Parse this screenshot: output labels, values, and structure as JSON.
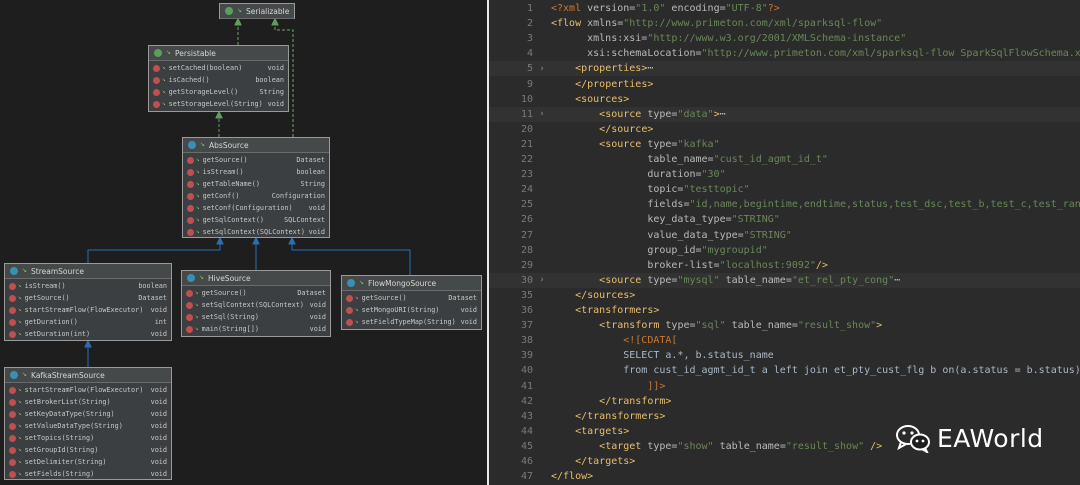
{
  "diagram": {
    "classes": [
      {
        "name": "Serializable",
        "kind": "interface",
        "methods": []
      },
      {
        "name": "Persistable",
        "kind": "interface",
        "methods": [
          {
            "name": "setCached(boolean)",
            "ret": "void"
          },
          {
            "name": "isCached()",
            "ret": "boolean"
          },
          {
            "name": "getStorageLevel()",
            "ret": "String"
          },
          {
            "name": "setStorageLevel(String)",
            "ret": "void"
          }
        ]
      },
      {
        "name": "AbsSource",
        "kind": "abstract",
        "methods": [
          {
            "name": "getSource()",
            "ret": "Dataset"
          },
          {
            "name": "isStream()",
            "ret": "boolean"
          },
          {
            "name": "getTableName()",
            "ret": "String"
          },
          {
            "name": "getConf()",
            "ret": "Configuration"
          },
          {
            "name": "setConf(Configuration)",
            "ret": "void"
          },
          {
            "name": "getSqlContext()",
            "ret": "SQLContext"
          },
          {
            "name": "setSqlContext(SQLContext)",
            "ret": "void"
          }
        ]
      },
      {
        "name": "StreamSource",
        "kind": "class",
        "methods": [
          {
            "name": "isStream()",
            "ret": "boolean"
          },
          {
            "name": "getSource()",
            "ret": "Dataset"
          },
          {
            "name": "startStreamFlow(FlowExecutor)",
            "ret": "void"
          },
          {
            "name": "getDuration()",
            "ret": "int"
          },
          {
            "name": "setDuration(int)",
            "ret": "void"
          }
        ]
      },
      {
        "name": "HiveSource",
        "kind": "class",
        "methods": [
          {
            "name": "getSource()",
            "ret": "Dataset"
          },
          {
            "name": "setSqlContext(SQLContext)",
            "ret": "void"
          },
          {
            "name": "setSql(String)",
            "ret": "void"
          },
          {
            "name": "main(String[])",
            "ret": "void"
          }
        ]
      },
      {
        "name": "FlowMongoSource",
        "kind": "class",
        "methods": [
          {
            "name": "getSource()",
            "ret": "Dataset"
          },
          {
            "name": "setMongoURI(String)",
            "ret": "void"
          },
          {
            "name": "setFieldTypeMap(String)",
            "ret": "void"
          }
        ]
      },
      {
        "name": "KafkaStreamSource",
        "kind": "class",
        "methods": [
          {
            "name": "startStreamFlow(FlowExecutor)",
            "ret": "void"
          },
          {
            "name": "setBrokerList(String)",
            "ret": "void"
          },
          {
            "name": "setKeyDataType(String)",
            "ret": "void"
          },
          {
            "name": "setValueDataType(String)",
            "ret": "void"
          },
          {
            "name": "setTopics(String)",
            "ret": "void"
          },
          {
            "name": "setGroupId(String)",
            "ret": "void"
          },
          {
            "name": "setDelimiter(String)",
            "ret": "void"
          },
          {
            "name": "setFields(String)",
            "ret": "void"
          }
        ]
      }
    ]
  },
  "editor": {
    "lines": [
      {
        "n": "1",
        "fold": "",
        "hl": false,
        "indent": 0,
        "parts": [
          [
            "pi",
            "<?xml "
          ],
          [
            "attr",
            "version="
          ],
          [
            "val",
            "\"1.0\" "
          ],
          [
            "attr",
            "encoding="
          ],
          [
            "val",
            "\"UTF-8\""
          ],
          [
            "pi",
            "?>"
          ]
        ]
      },
      {
        "n": "2",
        "fold": "",
        "hl": false,
        "indent": 0,
        "parts": [
          [
            "tag",
            "<flow "
          ],
          [
            "attr",
            "xmlns="
          ],
          [
            "val",
            "\"http://www.primeton.com/xml/sparksql-flow\""
          ]
        ]
      },
      {
        "n": "3",
        "fold": "",
        "hl": false,
        "indent": 6,
        "parts": [
          [
            "attr",
            "xmlns:xsi="
          ],
          [
            "val",
            "\"http://www.w3.org/2001/XMLSchema-instance\""
          ]
        ]
      },
      {
        "n": "4",
        "fold": "",
        "hl": false,
        "indent": 6,
        "parts": [
          [
            "attr",
            "xsi:schemaLocation="
          ],
          [
            "val",
            "\"http://www.primeton.com/xml/sparksql-flow SparkSqlFlowSchema.xsd\""
          ],
          [
            "tag",
            ">"
          ]
        ]
      },
      {
        "n": "5",
        "fold": "›",
        "hl": true,
        "indent": 4,
        "parts": [
          [
            "tag",
            "<properties>"
          ],
          [
            "attr",
            "⋯"
          ]
        ]
      },
      {
        "n": "9",
        "fold": "",
        "hl": false,
        "indent": 4,
        "parts": [
          [
            "tag",
            "</properties>"
          ]
        ]
      },
      {
        "n": "10",
        "fold": "",
        "hl": false,
        "indent": 4,
        "parts": [
          [
            "tag",
            "<sources>"
          ]
        ]
      },
      {
        "n": "11",
        "fold": "›",
        "hl": true,
        "indent": 8,
        "parts": [
          [
            "tag",
            "<source "
          ],
          [
            "attr",
            "type="
          ],
          [
            "val",
            "\"data\""
          ],
          [
            "tag",
            ">"
          ],
          [
            "attr",
            "⋯"
          ]
        ]
      },
      {
        "n": "20",
        "fold": "",
        "hl": false,
        "indent": 8,
        "parts": [
          [
            "tag",
            "</source>"
          ]
        ]
      },
      {
        "n": "21",
        "fold": "",
        "hl": false,
        "indent": 8,
        "parts": [
          [
            "tag",
            "<source "
          ],
          [
            "attr",
            "type="
          ],
          [
            "val",
            "\"kafka\""
          ]
        ]
      },
      {
        "n": "22",
        "fold": "",
        "hl": false,
        "indent": 16,
        "parts": [
          [
            "attr",
            "table_name="
          ],
          [
            "val",
            "\"cust_id_agmt_id_t\""
          ]
        ]
      },
      {
        "n": "23",
        "fold": "",
        "hl": false,
        "indent": 16,
        "parts": [
          [
            "attr",
            "duration="
          ],
          [
            "val",
            "\"30\""
          ]
        ]
      },
      {
        "n": "24",
        "fold": "",
        "hl": false,
        "indent": 16,
        "parts": [
          [
            "attr",
            "topic="
          ],
          [
            "val",
            "\"testtopic\""
          ]
        ]
      },
      {
        "n": "25",
        "fold": "",
        "hl": false,
        "indent": 16,
        "parts": [
          [
            "attr",
            "fields="
          ],
          [
            "val",
            "\"id,name,begintime,endtime,status,test_dsc,test_b,test_c,test_rand,created_at\""
          ]
        ]
      },
      {
        "n": "26",
        "fold": "",
        "hl": false,
        "indent": 16,
        "parts": [
          [
            "attr",
            "key_data_type="
          ],
          [
            "val",
            "\"STRING\""
          ]
        ]
      },
      {
        "n": "27",
        "fold": "",
        "hl": false,
        "indent": 16,
        "parts": [
          [
            "attr",
            "value_data_type="
          ],
          [
            "val",
            "\"STRING\""
          ]
        ]
      },
      {
        "n": "28",
        "fold": "",
        "hl": false,
        "indent": 16,
        "parts": [
          [
            "attr",
            "group_id="
          ],
          [
            "val",
            "\"mygroupid\""
          ]
        ]
      },
      {
        "n": "29",
        "fold": "",
        "hl": false,
        "indent": 16,
        "parts": [
          [
            "attr",
            "broker-list="
          ],
          [
            "val",
            "\"localhost:9092\""
          ],
          [
            "tag",
            "/>"
          ]
        ]
      },
      {
        "n": "30",
        "fold": "›",
        "hl": true,
        "indent": 8,
        "parts": [
          [
            "tag",
            "<source "
          ],
          [
            "attr",
            "type="
          ],
          [
            "val",
            "\"mysql\" "
          ],
          [
            "attr",
            "table_name="
          ],
          [
            "val",
            "\"et_rel_pty_cong\""
          ],
          [
            "attr",
            "⋯"
          ]
        ]
      },
      {
        "n": "35",
        "fold": "",
        "hl": false,
        "indent": 4,
        "parts": [
          [
            "tag",
            "</sources>"
          ]
        ]
      },
      {
        "n": "36",
        "fold": "",
        "hl": false,
        "indent": 4,
        "parts": [
          [
            "tag",
            "<transformers>"
          ]
        ]
      },
      {
        "n": "37",
        "fold": "",
        "hl": false,
        "indent": 8,
        "parts": [
          [
            "tag",
            "<transform "
          ],
          [
            "attr",
            "type="
          ],
          [
            "val",
            "\"sql\" "
          ],
          [
            "attr",
            "table_name="
          ],
          [
            "val",
            "\"result_show\""
          ],
          [
            "tag",
            ">"
          ]
        ]
      },
      {
        "n": "38",
        "fold": "",
        "hl": false,
        "indent": 12,
        "parts": [
          [
            "cd",
            "<![CDATA["
          ]
        ]
      },
      {
        "n": "39",
        "fold": "",
        "hl": false,
        "indent": 12,
        "parts": [
          [
            "txt",
            "SELECT a.*, b.status_name"
          ]
        ]
      },
      {
        "n": "40",
        "fold": "",
        "hl": false,
        "indent": 12,
        "parts": [
          [
            "txt",
            "from cust_id_agmt_id_t a left join et_pty_cust_flg b on(a.status = b.status)"
          ]
        ]
      },
      {
        "n": "41",
        "fold": "",
        "hl": false,
        "indent": 16,
        "parts": [
          [
            "cd",
            "]]>"
          ]
        ]
      },
      {
        "n": "42",
        "fold": "",
        "hl": false,
        "indent": 8,
        "parts": [
          [
            "tag",
            "</transform>"
          ]
        ]
      },
      {
        "n": "43",
        "fold": "",
        "hl": false,
        "indent": 4,
        "parts": [
          [
            "tag",
            "</transformers>"
          ]
        ]
      },
      {
        "n": "44",
        "fold": "",
        "hl": false,
        "indent": 4,
        "parts": [
          [
            "tag",
            "<targets>"
          ]
        ]
      },
      {
        "n": "45",
        "fold": "",
        "hl": false,
        "indent": 8,
        "parts": [
          [
            "tag",
            "<target "
          ],
          [
            "attr",
            "type="
          ],
          [
            "val",
            "\"show\" "
          ],
          [
            "attr",
            "table_name="
          ],
          [
            "val",
            "\"result_show\""
          ],
          [
            "tag",
            " />"
          ]
        ]
      },
      {
        "n": "46",
        "fold": "",
        "hl": false,
        "indent": 4,
        "parts": [
          [
            "tag",
            "</targets>"
          ]
        ]
      },
      {
        "n": "47",
        "fold": "",
        "hl": false,
        "indent": 0,
        "parts": [
          [
            "tag",
            "</flow>"
          ]
        ]
      }
    ]
  },
  "watermark": {
    "text": "EAWorld",
    "icon": "wechat-icon"
  }
}
